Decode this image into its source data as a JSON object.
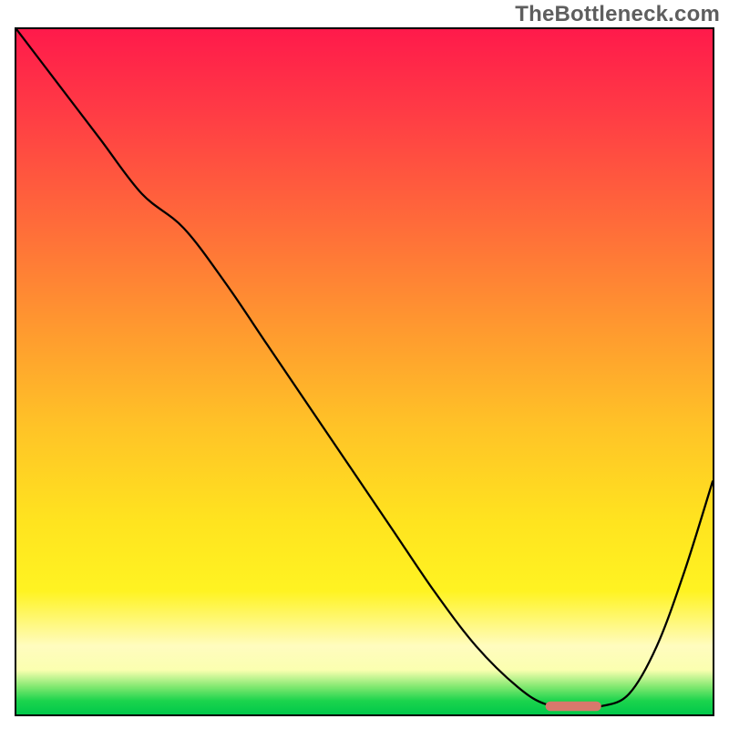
{
  "watermark": "TheBottleneck.com",
  "chart_data": {
    "type": "line",
    "title": "",
    "xlabel": "",
    "ylabel": "",
    "xlim": [
      0,
      100
    ],
    "ylim": [
      0,
      100
    ],
    "grid": false,
    "series": [
      {
        "name": "curve",
        "x": [
          0,
          6,
          12,
          18,
          24,
          30,
          36,
          42,
          48,
          54,
          60,
          66,
          72,
          76,
          80,
          84,
          88,
          92,
          96,
          100
        ],
        "y": [
          100,
          92,
          84,
          76,
          71,
          63,
          54,
          45,
          36,
          27,
          18,
          10,
          4,
          1.5,
          1.2,
          1.2,
          3,
          10,
          21,
          34
        ]
      }
    ],
    "marker": {
      "x_start": 76,
      "x_end": 84,
      "y": 1.2,
      "color": "#d9786c"
    },
    "background_gradient": {
      "stops": [
        {
          "pos": 0,
          "color": "#ff1a4b"
        },
        {
          "pos": 0.12,
          "color": "#ff3b45"
        },
        {
          "pos": 0.28,
          "color": "#ff6a3a"
        },
        {
          "pos": 0.44,
          "color": "#ff9a2f"
        },
        {
          "pos": 0.58,
          "color": "#ffc327"
        },
        {
          "pos": 0.72,
          "color": "#ffe41f"
        },
        {
          "pos": 0.82,
          "color": "#fff322"
        },
        {
          "pos": 0.9,
          "color": "#fffcbf"
        },
        {
          "pos": 0.935,
          "color": "#fbffb0"
        },
        {
          "pos": 0.96,
          "color": "#7fe86f"
        },
        {
          "pos": 0.98,
          "color": "#1cd44d"
        },
        {
          "pos": 1.0,
          "color": "#00c84a"
        }
      ]
    }
  }
}
